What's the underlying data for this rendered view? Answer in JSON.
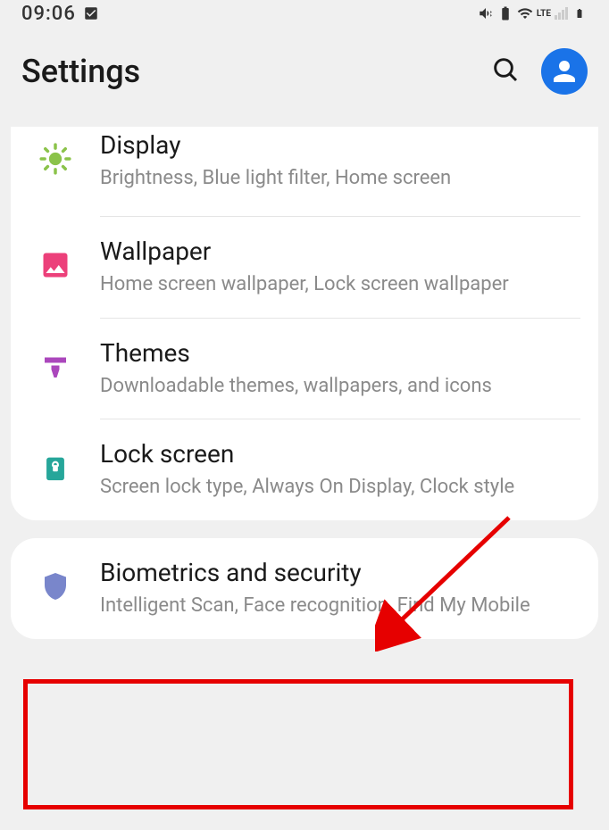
{
  "status": {
    "time": "09:06",
    "lte": "LTE"
  },
  "header": {
    "title": "Settings"
  },
  "groups": [
    {
      "items": [
        {
          "title": "Display",
          "desc": "Brightness, Blue light filter, Home screen",
          "icon": "sun"
        },
        {
          "title": "Wallpaper",
          "desc": "Home screen wallpaper, Lock screen wallpaper",
          "icon": "pic"
        },
        {
          "title": "Themes",
          "desc": "Downloadable themes, wallpapers, and icons",
          "icon": "brush"
        },
        {
          "title": "Lock screen",
          "desc": "Screen lock type, Always On Display, Clock style",
          "icon": "lock"
        }
      ]
    },
    {
      "items": [
        {
          "title": "Biometrics and security",
          "desc": "Intelligent Scan, Face recognition, Find My Mobile",
          "icon": "shield"
        }
      ]
    }
  ],
  "annotation": {
    "highlight_target": "Biometrics and security"
  }
}
